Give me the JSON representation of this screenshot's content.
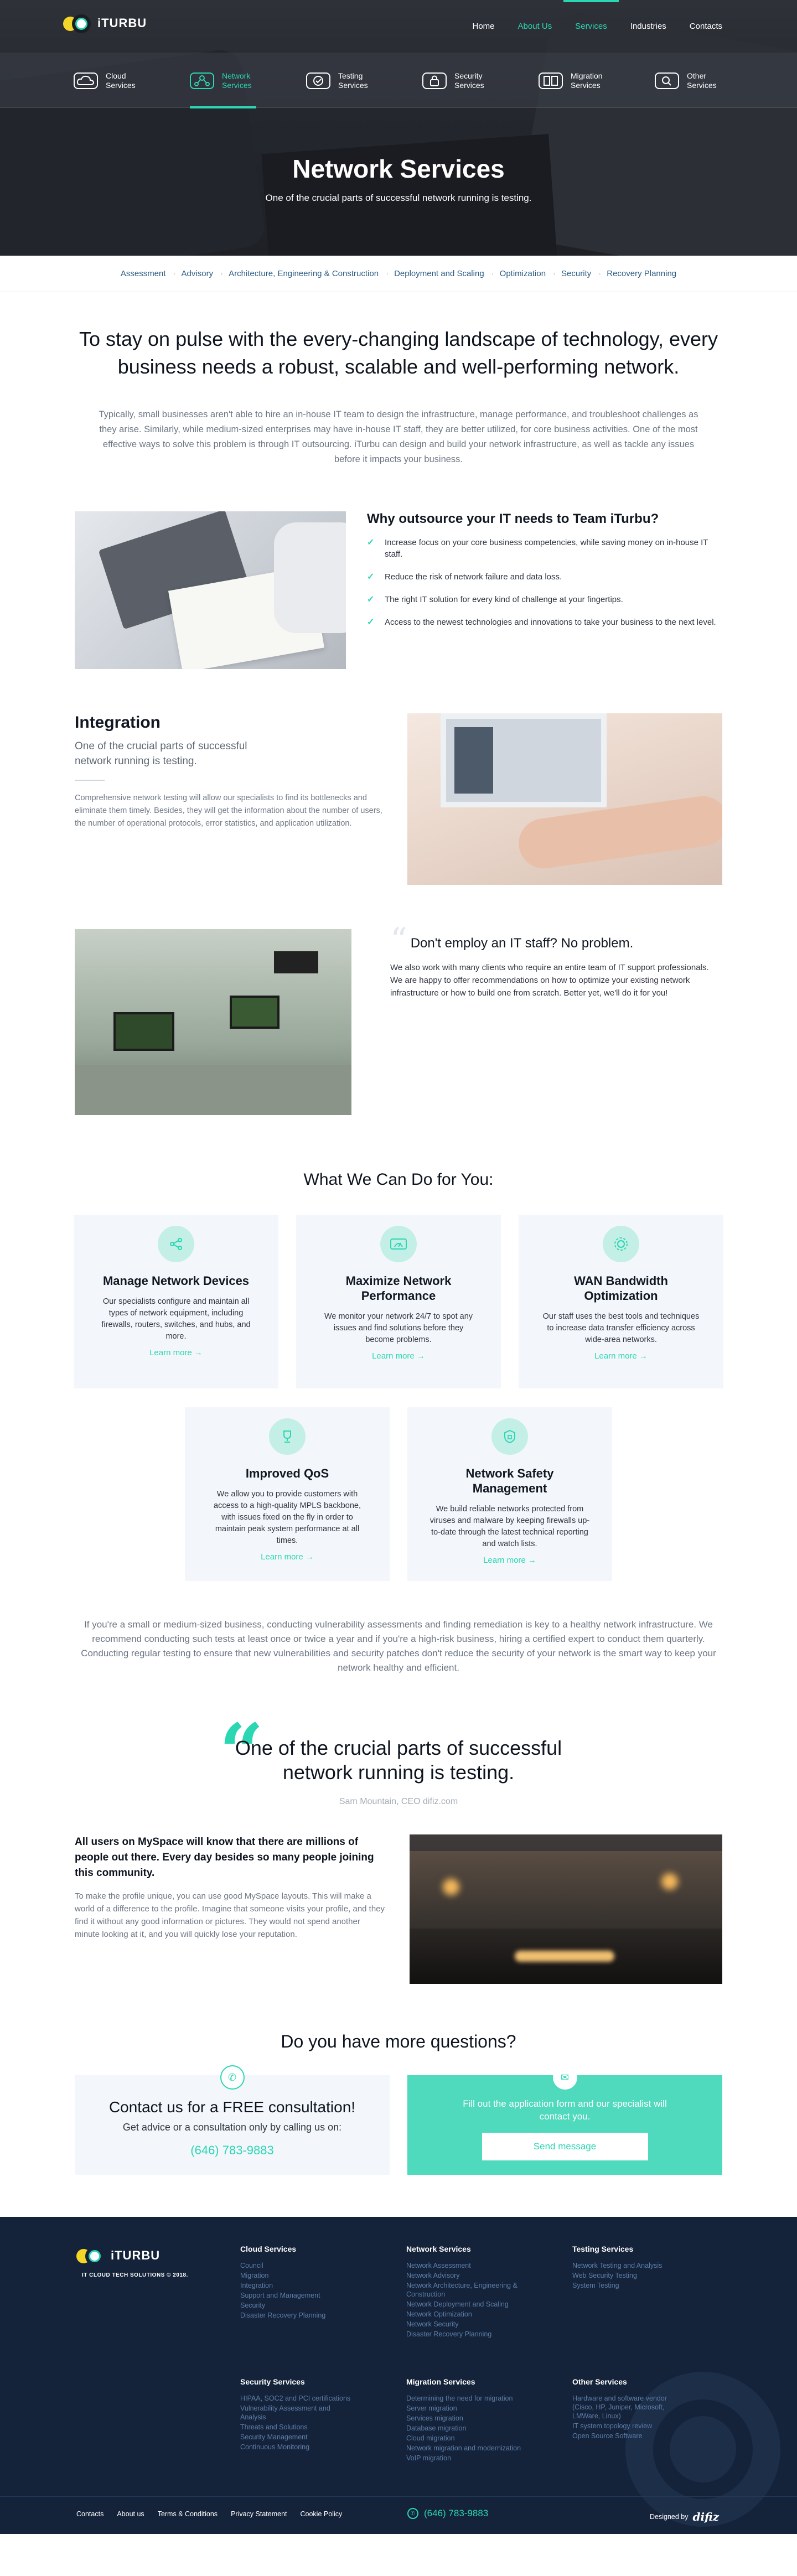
{
  "brand": {
    "name": "iTURBU",
    "footer_tagline": "IT CLOUD TECH SOLUTIONS © 2018."
  },
  "nav": {
    "items": [
      {
        "label": "Home"
      },
      {
        "label": "About Us"
      },
      {
        "label": "Services"
      },
      {
        "label": "Industries"
      },
      {
        "label": "Contacts"
      }
    ]
  },
  "subnav": {
    "items": [
      {
        "label": "Cloud Services",
        "icon": "cloud-icon"
      },
      {
        "label": "Network Services",
        "icon": "network-icon"
      },
      {
        "label": "Testing Services",
        "icon": "testing-icon"
      },
      {
        "label": "Security Services",
        "icon": "lock-icon"
      },
      {
        "label": "Migration Services",
        "icon": "migration-icon"
      },
      {
        "label": "Other Services",
        "icon": "search-icon"
      }
    ]
  },
  "hero": {
    "title": "Network Services",
    "subtitle": "One of the crucial parts of successful network running is testing."
  },
  "tags": [
    "Assessment",
    "Advisory",
    "Architecture, Engineering & Construction",
    "Deployment and Scaling",
    "Optimization",
    "Security",
    "Recovery Planning"
  ],
  "intro": {
    "heading": "To stay on pulse with the every-changing landscape of technology, every business needs a robust, scalable and well-performing network.",
    "text": "Typically, small businesses  aren't able to hire an in-house IT team to design the infrastructure, manage performance, and troubleshoot challenges as they arise. Similarly, while medium-sized enterprises may have in-house IT staff, they are better utilized, for core business activities. One of the most effective ways to solve this problem is through IT outsourcing. iTurbu can design and build your network infrastructure, as well as tackle any issues before it impacts your business."
  },
  "why": {
    "title": "Why outsource your IT needs to Team iTurbu?",
    "items": [
      " Increase focus on your core business competencies, while saving money on in-house IT staff.",
      "Reduce the risk of network failure and data loss.",
      "The right IT solution for every kind of challenge at your fingertips.",
      "Access to the newest technologies and innovations to take your business to the next level."
    ]
  },
  "integration": {
    "title": "Integration",
    "lead": "One of the crucial parts of successful network running is testing.",
    "text": "Comprehensive network testing will allow our specialists to find its bottlenecks and eliminate them timely. Besides, they will get the information about the number of users, the number of operational protocols, error statistics, and application utilization."
  },
  "staff": {
    "title": "Don't employ an IT staff? No problem.",
    "text": "We also work with many clients who require an entire team of IT support professionals. We are happy to offer recommendations on how to optimize your existing network infrastructure or how to build one from scratch. Better yet, we'll do it for you!"
  },
  "services": {
    "title": "What We Can Do for You:",
    "more_label": "Learn more →",
    "cards": [
      {
        "title": "Manage Network Devices",
        "text": "Our specialists configure and maintain all types of network equipment, including firewalls, routers, switches, and hubs, and more.",
        "icon": "share-icon"
      },
      {
        "title": "Maximize Network Performance",
        "text": "We monitor your network 24/7 to spot any issues and find solutions before they become problems.",
        "icon": "gauge-icon"
      },
      {
        "title": "WAN Bandwidth Optimization",
        "text": "Our staff uses the best tools and techniques to increase data transfer efficiency across wide-area networks.",
        "icon": "gear-icon"
      },
      {
        "title": "Improved QoS",
        "text": "We allow you to provide customers with access to a high-quality MPLS backbone, with issues fixed on the fly in order to maintain peak system performance at all times.",
        "icon": "trophy-icon"
      },
      {
        "title": "Network Safety Management",
        "text": "We build reliable networks protected from viruses and malware by keeping firewalls up-to-date through the latest technical reporting and watch lists.",
        "icon": "shield-icon"
      }
    ],
    "para1": "If you're a small or medium-sized business, conducting vulnerability assessments and finding remediation is key to a healthy network infrastructure. We recommend conducting such tests at least once or twice a year and if you're a high-risk business, hiring a certified expert to conduct them quarterly.",
    "para2": "Conducting regular testing to ensure that new vulnerabilities and security patches don't reduce the security of your network is the smart way to keep your network healthy and efficient."
  },
  "quote": {
    "text": "One of the crucial parts of successful network running is testing.",
    "author": "Sam Mountain, CEO difiz.com"
  },
  "myspace": {
    "title": "All users on MySpace will know that there are millions of people out there. Every day besides so many people joining this community.",
    "text": "To make the profile unique, you can use good MySpace layouts. This will make a world of a difference to the profile. Imagine that someone visits your profile, and they find it without any good information or pictures. They would not spend another minute looking at it, and you will quickly lose your reputation."
  },
  "questions": {
    "title": "Do you have more questions?",
    "left_title": "Contact us for a FREE consultation!",
    "left_sub": "Get advice or a consultation only by calling us on:",
    "phone": "(646) 783-9883",
    "right_text": "Fill out the application form and our specialist will contact you.",
    "right_button": "Send message"
  },
  "footer": {
    "cols": [
      {
        "title": "Cloud Services",
        "links": [
          "Council",
          "Migration",
          "Integration",
          "Support and Management",
          "Security",
          "Disaster Recovery Planning"
        ]
      },
      {
        "title": "Network Services",
        "links": [
          "Network Assessment",
          "Network Advisory",
          "Network Architecture, Engineering & Construction",
          "Network Deployment and Scaling",
          "Network Optimization",
          "Network Security",
          "Disaster Recovery Planning"
        ]
      },
      {
        "title": "Testing Services",
        "links": [
          "Network Testing and Analysis",
          "Web Security Testing",
          "System Testing"
        ]
      },
      {
        "title": "Security Services",
        "links": [
          "HIPAA, SOC2 and PCI certifications",
          "Vulnerability Assessment and Analysis",
          "Threats and Solutions",
          "Security Management",
          "Continuous Monitoring"
        ]
      },
      {
        "title": "Migration Services",
        "links": [
          "Determining the need for migration",
          "Server migration",
          "Services migration",
          "Database migration",
          "Cloud migration",
          "Network migration and modernization",
          "VoIP migration"
        ]
      },
      {
        "title": "Other Services",
        "links": [
          "Hardware and software vendor (Cisco, HP, Juniper, Microsoft, LMWare, Linux)",
          "IT system topology review",
          "Open Source Software"
        ]
      }
    ],
    "bottom_links": [
      "Contacts",
      "About us",
      "Terms & Conditions",
      "Privacy Statement",
      "Cookie Policy"
    ],
    "phone": "(646) 783-9883",
    "designed_by": "Designed by",
    "designer": "difiz"
  }
}
